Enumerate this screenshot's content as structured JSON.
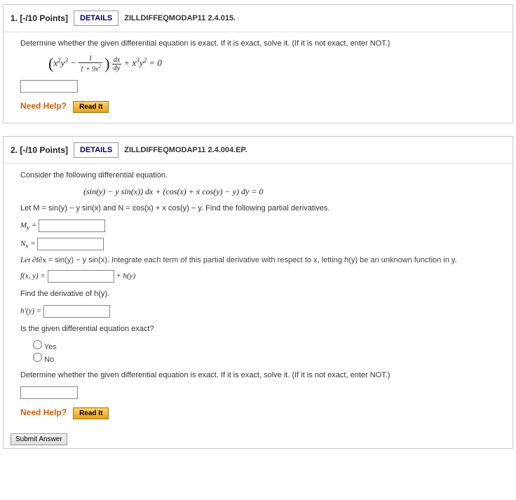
{
  "q1": {
    "points": "1. [-/10 Points]",
    "details": "DETAILS",
    "source": "ZILLDIFFEQMODAP11 2.4.015.",
    "intro": "Determine whether the given differential equation is exact. If it is exact, solve it. (If it is not exact, enter NOT.)",
    "needHelp": "Need Help?",
    "readIt": "Read It"
  },
  "q2": {
    "points": "2. [-/10 Points]",
    "details": "DETAILS",
    "source": "ZILLDIFFEQMODAP11 2.4.004.EP.",
    "intro": "Consider the following differential equation.",
    "equation": "(sin(y) − y sin(x)) dx + (cos(x) + x cos(y) − y) dy = 0",
    "letMN": "Let M = sin(y) − y sin(x) and N = cos(x) + x cos(y) − y. Find the following partial derivatives.",
    "my": "M",
    "my_sub": "y",
    "nx": "N",
    "nx_sub": "x",
    "eq": " = ",
    "letdf": "Let ",
    "dfdx_num": "∂f",
    "dfdx_den": "∂x",
    "dfdx_tail": " = sin(y) − y sin(x). Integrate each term of this partial derivative with respect to x, letting h(y) be an unknown function in y.",
    "fxy": "f(x, y) = ",
    "plus_hy": " + h(y)",
    "find_h": "Find the derivative of h(y).",
    "hprime": "h'(y) = ",
    "isExactQ": "Is the given differential equation exact?",
    "yes": "Yes",
    "no": "No",
    "determine": "Determine whether the given differential equation is exact. If it is exact, solve it. (If it is not exact, enter NOT.)",
    "needHelp": "Need Help?",
    "readIt": "Read It",
    "submit": "Submit Answer"
  }
}
